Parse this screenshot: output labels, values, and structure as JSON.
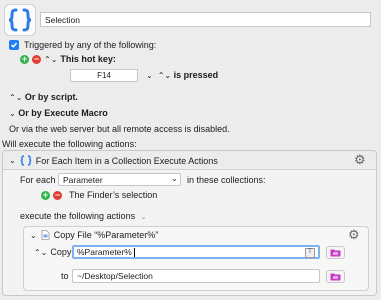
{
  "macro": {
    "name": "Selection"
  },
  "trigger": {
    "heading": "Triggered by any of the following:",
    "hotkey_label": "This hot key:",
    "hotkey_value": "F14",
    "hotkey_state": "is pressed",
    "or_script": "Or by script.",
    "or_execute_macro": "Or by Execute Macro",
    "web_server_note": "Or via the web server but all remote access is disabled."
  },
  "actions": {
    "heading": "Will execute the following actions:",
    "for_each": {
      "title": "For Each Item in a Collection Execute Actions",
      "for_each_label": "For each",
      "variable": "Parameter",
      "in_collections": "in these collections:",
      "collection_item": "The Finder’s selection",
      "execute_label": "execute the following actions",
      "copy_file": {
        "title": "Copy File “%Parameter%”",
        "copy_label": "Copy",
        "source": "%Parameter%",
        "to_label": "to",
        "destination": "~/Desktop/Selection"
      }
    }
  },
  "colors": {
    "accent": "#1f7cf2",
    "add": "#2fb34a",
    "remove": "#e23b36",
    "folder": "#c23cc4",
    "macro_icon": "#2d7be6"
  }
}
